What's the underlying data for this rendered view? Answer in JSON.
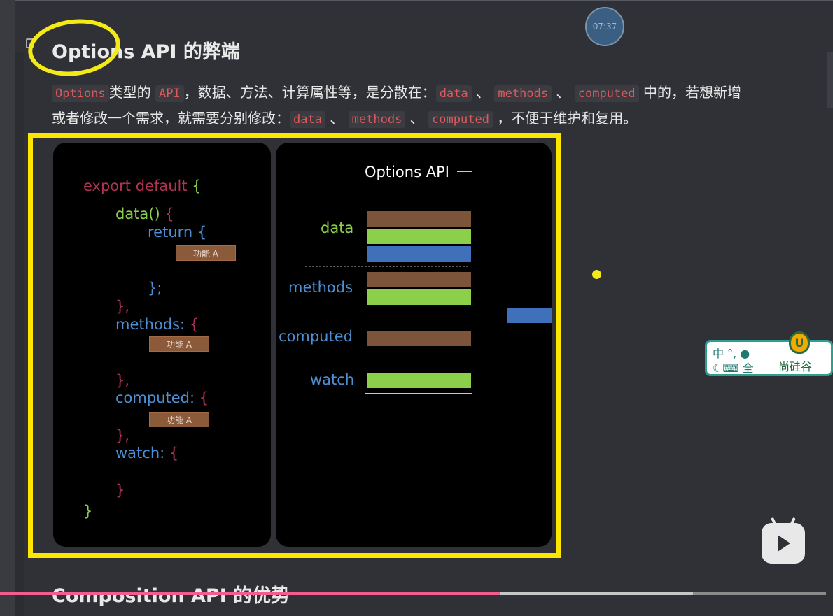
{
  "timer": "07:37",
  "section": {
    "title": "Options API 的弊端",
    "para_line1": [
      {
        "t": "code",
        "v": "Options"
      },
      {
        "t": "text",
        "v": "类型的 "
      },
      {
        "t": "code",
        "v": "API"
      },
      {
        "t": "text",
        "v": "，数据、方法、计算属性等，是分散在："
      },
      {
        "t": "code",
        "v": "data"
      },
      {
        "t": "text",
        "v": " 、 "
      },
      {
        "t": "code",
        "v": "methods"
      },
      {
        "t": "text",
        "v": " 、 "
      },
      {
        "t": "code",
        "v": "computed"
      },
      {
        "t": "text",
        "v": " 中的，若想新增"
      }
    ],
    "para_line2": [
      {
        "t": "text",
        "v": "或者修改一个需求，就需要分别修改："
      },
      {
        "t": "code",
        "v": "data"
      },
      {
        "t": "text",
        "v": " 、 "
      },
      {
        "t": "code",
        "v": "methods"
      },
      {
        "t": "text",
        "v": " 、 "
      },
      {
        "t": "code",
        "v": "computed"
      },
      {
        "t": "text",
        "v": " ，不便于维护和复用。"
      }
    ]
  },
  "code_panel": {
    "export_default": "export  default",
    "brace_open": "{",
    "data_fn": "data()",
    "brace_open_red": "{",
    "return_kw": "return",
    "return_brace": "{",
    "close_semicolon": "};",
    "close_comma": "},",
    "methods_key": "methods:",
    "computed_key": "computed:",
    "watch_key": "watch:",
    "close_brace": "}",
    "func_a": "功能 A"
  },
  "options_diagram": {
    "title": "Options API",
    "labels": [
      "data",
      "methods",
      "computed",
      "watch"
    ]
  },
  "ime": {
    "row1": "中 °, ",
    "row2": "全",
    "brand": "尚硅谷",
    "logo": "U"
  },
  "next_section_title": "Composition API 的优势",
  "video": {
    "progress": 0.6
  }
}
